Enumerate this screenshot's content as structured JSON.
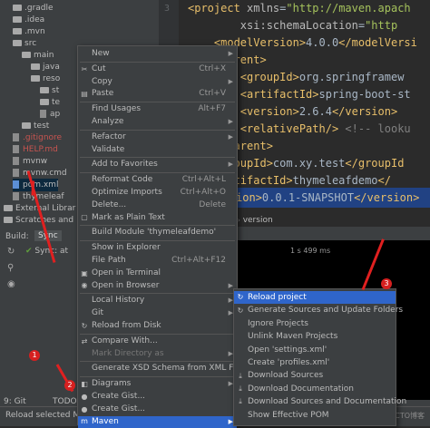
{
  "tree": [
    {
      "label": ".gradle",
      "kind": "folder"
    },
    {
      "label": ".idea",
      "kind": "folder"
    },
    {
      "label": ".mvn",
      "kind": "folder"
    },
    {
      "label": "src",
      "kind": "folder"
    },
    {
      "label": "main",
      "kind": "folder"
    },
    {
      "label": "java",
      "kind": "folder"
    },
    {
      "label": "reso",
      "kind": "folder"
    },
    {
      "label": "st",
      "kind": "folder"
    },
    {
      "label": "te",
      "kind": "folder"
    },
    {
      "label": "ap",
      "kind": "file"
    },
    {
      "label": "test",
      "kind": "folder"
    },
    {
      "label": ".gitignore",
      "kind": "file"
    },
    {
      "label": "HELP.md",
      "kind": "file"
    },
    {
      "label": "mvnw",
      "kind": "file"
    },
    {
      "label": "mvnw.cmd",
      "kind": "file"
    },
    {
      "label": "pom.xml",
      "kind": "file"
    },
    {
      "label": "thymeleaf",
      "kind": "file"
    },
    {
      "label": "External Librar",
      "kind": "folder"
    },
    {
      "label": "Scratches and",
      "kind": "folder"
    }
  ],
  "editor": {
    "line_number_visible": "3",
    "lines": [
      {
        "parts": [
          [
            "tag",
            "<project "
          ],
          [
            "attr",
            "xmlns"
          ],
          [
            "txt",
            "="
          ],
          [
            "val",
            "\"http://maven.apach"
          ]
        ]
      },
      {
        "parts": [
          [
            "attr",
            "        xsi:schemaLocation"
          ],
          [
            "txt",
            "="
          ],
          [
            "val",
            "\"http"
          ]
        ]
      },
      {
        "parts": [
          [
            "tag",
            "    <modelVersion>"
          ],
          [
            "txt",
            "4.0.0"
          ],
          [
            "tag",
            "</modelVersi"
          ]
        ]
      },
      {
        "parts": [
          [
            "tag",
            "    <parent>"
          ]
        ]
      },
      {
        "parts": [
          [
            "tag",
            "        <groupId>"
          ],
          [
            "txt",
            "org.springframew"
          ]
        ]
      },
      {
        "parts": [
          [
            "tag",
            "        <artifactId>"
          ],
          [
            "txt",
            "spring-boot-st"
          ]
        ]
      },
      {
        "parts": [
          [
            "tag",
            "        <version>"
          ],
          [
            "txt",
            "2.6.4"
          ],
          [
            "tag",
            "</version>"
          ]
        ]
      },
      {
        "parts": [
          [
            "tag",
            "        <relativePath/> "
          ],
          [
            "cmt",
            "<!-- looku"
          ]
        ]
      },
      {
        "parts": [
          [
            "tag",
            "    </parent>"
          ]
        ]
      },
      {
        "parts": [
          [
            "tag",
            "    <groupId>"
          ],
          [
            "txt",
            "com.xy.test"
          ],
          [
            "tag",
            "</groupId"
          ]
        ]
      },
      {
        "parts": [
          [
            "tag",
            "    <artifactId>"
          ],
          [
            "txt",
            "thymeleafdemo"
          ],
          [
            "tag",
            "</"
          ]
        ]
      },
      {
        "parts": [
          [
            "tag",
            "    <version>"
          ],
          [
            "txt",
            "0.0.1-SNAPSHOT"
          ],
          [
            "tag",
            "</version>"
          ]
        ]
      }
    ],
    "breadcrumb": "version"
  },
  "bottom": {
    "build_tab": "Build:",
    "sync_tab": "Sync",
    "sync_label": "Sync: at",
    "time": "1 s 499 ms",
    "git_tab": "9: Git",
    "todo_tab": "TODO",
    "status": "Reload selected Ma",
    "watermark": "@51CTO博客"
  },
  "context_menu": [
    {
      "label": "New",
      "sub": true
    },
    {
      "sep": true
    },
    {
      "label": "Cut",
      "shortcut": "Ctrl+X",
      "icon": "✂"
    },
    {
      "label": "Copy",
      "sub": true
    },
    {
      "label": "Paste",
      "shortcut": "Ctrl+V",
      "icon": "▤"
    },
    {
      "sep": true
    },
    {
      "label": "Find Usages",
      "shortcut": "Alt+F7"
    },
    {
      "label": "Analyze",
      "sub": true
    },
    {
      "sep": true
    },
    {
      "label": "Refactor",
      "sub": true
    },
    {
      "label": "Validate"
    },
    {
      "sep": true
    },
    {
      "label": "Add to Favorites",
      "sub": true
    },
    {
      "sep": true
    },
    {
      "label": "Reformat Code",
      "shortcut": "Ctrl+Alt+L"
    },
    {
      "label": "Optimize Imports",
      "shortcut": "Ctrl+Alt+O"
    },
    {
      "label": "Delete...",
      "shortcut": "Delete"
    },
    {
      "label": "Mark as Plain Text",
      "icon": "▢"
    },
    {
      "sep": true
    },
    {
      "label": "Build Module 'thymeleafdemo'"
    },
    {
      "sep": true
    },
    {
      "label": "Show in Explorer"
    },
    {
      "label": "File Path",
      "shortcut": "Ctrl+Alt+F12"
    },
    {
      "label": "Open in Terminal",
      "icon": "▣"
    },
    {
      "label": "Open in Browser",
      "sub": true,
      "icon": "◉"
    },
    {
      "sep": true
    },
    {
      "label": "Local History",
      "sub": true
    },
    {
      "label": "Git",
      "sub": true
    },
    {
      "label": "Reload from Disk",
      "icon": "↻"
    },
    {
      "sep": true
    },
    {
      "label": "Compare With...",
      "icon": "⇄"
    },
    {
      "label": "Mark Directory as",
      "sub": true,
      "disabled": true
    },
    {
      "sep": true
    },
    {
      "label": "Generate XSD Schema from XML File..."
    },
    {
      "sep": true
    },
    {
      "label": "Diagrams",
      "sub": true,
      "icon": "◧"
    },
    {
      "label": "Create Gist...",
      "icon": "●"
    },
    {
      "label": "Create Gist...",
      "icon": "●"
    },
    {
      "label": "Maven",
      "sub": true,
      "selected": true,
      "icon": "m"
    }
  ],
  "maven_menu": [
    {
      "label": "Reload project",
      "selected": true,
      "icon": "↻"
    },
    {
      "label": "Generate Sources and Update Folders",
      "icon": "↻"
    },
    {
      "label": "Ignore Projects"
    },
    {
      "label": "Unlink Maven Projects"
    },
    {
      "label": "Open 'settings.xml'"
    },
    {
      "label": "Create 'profiles.xml'"
    },
    {
      "label": "Download Sources",
      "icon": "⤓"
    },
    {
      "label": "Download Documentation",
      "icon": "⤓"
    },
    {
      "label": "Download Sources and Documentation",
      "icon": "⤓"
    },
    {
      "label": "Show Effective POM"
    }
  ],
  "annotations": [
    "1",
    "2",
    "3"
  ]
}
